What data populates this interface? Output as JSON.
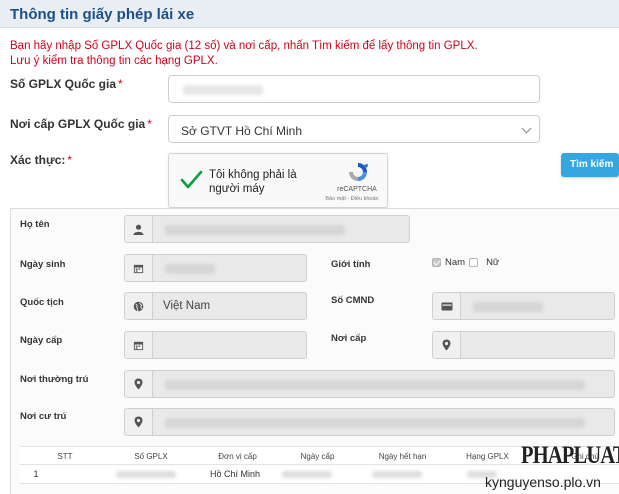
{
  "header": {
    "title": "Thông tin giấy phép lái xe"
  },
  "notice": {
    "line1": "Bạn hãy nhập Số GPLX Quốc gia (12 số) và nơi cấp, nhấn Tìm kiếm để lấy thông tin GPLX.",
    "line2": "Lưu ý kiểm tra thông tin các hạng GPLX."
  },
  "form": {
    "license_number": {
      "label": "Số GPLX Quốc gia",
      "required_mark": "*"
    },
    "issuing_place": {
      "label": "Nơi cấp GPLX Quốc gia",
      "required_mark": "*",
      "selected": "Sở GTVT Hồ Chí Minh"
    },
    "verify": {
      "label": "Xác thực:",
      "required_mark": "*"
    },
    "captcha": {
      "text": "Tôi không phải là người máy",
      "brand": "reCAPTCHA",
      "terms": "Bảo mật - Điều khoản",
      "checked": true
    },
    "search_button": "Tìm kiếm"
  },
  "result": {
    "full_name": {
      "label": "Họ tên"
    },
    "dob": {
      "label": "Ngày sinh"
    },
    "gender": {
      "label": "Giới tính",
      "options": [
        "Nam",
        "Nữ"
      ],
      "selected": "Nam"
    },
    "nationality": {
      "label": "Quốc tịch",
      "value": "Việt Nam"
    },
    "id_number": {
      "label": "Số CMND"
    },
    "issue_date": {
      "label": "Ngày cấp"
    },
    "issue_place": {
      "label": "Nơi cấp"
    },
    "permanent_address": {
      "label": "Nơi thường trú"
    },
    "residence": {
      "label": "Nơi cư trú"
    },
    "table": {
      "columns": [
        "STT",
        "Số GPLX",
        "Đơn vị cấp",
        "Ngày cấp",
        "Ngày hết hạn",
        "Hạng GPLX",
        "Ghi chú"
      ],
      "rows": [
        {
          "stt": "1",
          "unit": "Hồ Chí Minh"
        }
      ]
    }
  },
  "watermark": {
    "logo": "PHAPLUAT",
    "site": "kynguyenso.plo.vn"
  },
  "colors": {
    "title": "#1c4f8a",
    "notice": "#d0021b",
    "button": "#35a7e0"
  }
}
